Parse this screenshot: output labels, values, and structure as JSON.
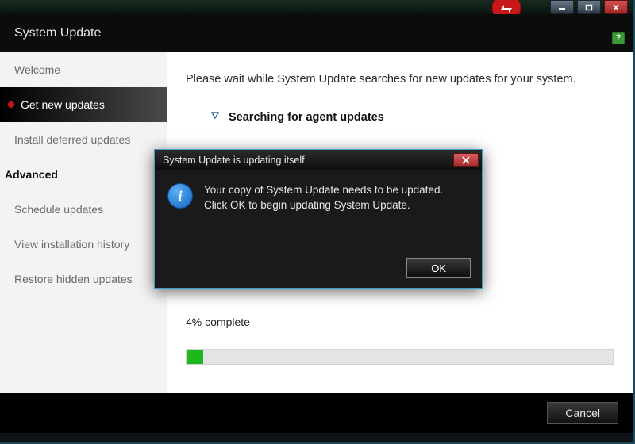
{
  "app": {
    "title": "System Update"
  },
  "sidebar": {
    "items": [
      {
        "label": "Welcome"
      },
      {
        "label": "Get new updates"
      },
      {
        "label": "Install deferred updates"
      }
    ],
    "advanced_heading": "Advanced",
    "advanced_items": [
      {
        "label": "Schedule updates"
      },
      {
        "label": "View installation history"
      },
      {
        "label": "Restore hidden updates"
      }
    ]
  },
  "content": {
    "intro": "Please wait while System Update searches for new updates for your system.",
    "searching_label": "Searching for agent updates",
    "progress_label": "4% complete",
    "progress_percent": 4
  },
  "footer": {
    "cancel_label": "Cancel"
  },
  "dialog": {
    "title": "System Update is updating itself",
    "message": "Your copy of System Update needs to be updated. Click OK to begin updating System Update.",
    "ok_label": "OK"
  },
  "colors": {
    "accent_red": "#c81818",
    "progress_green": "#1eb81e",
    "dialog_border": "#3aa0c8"
  }
}
